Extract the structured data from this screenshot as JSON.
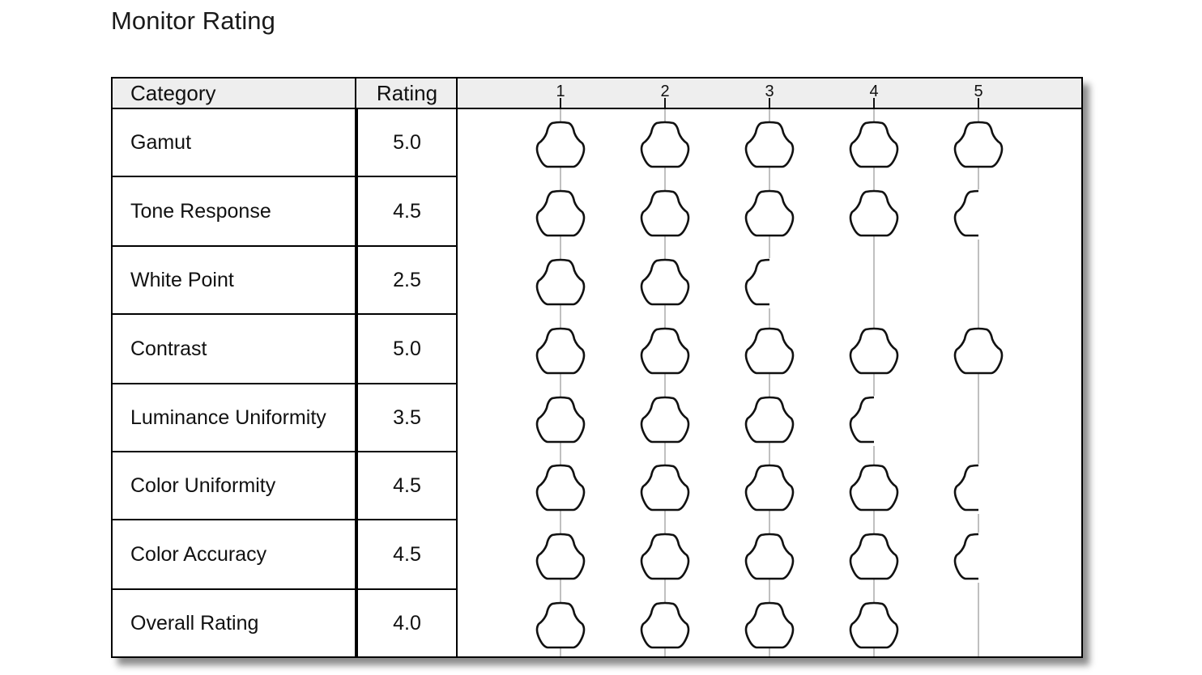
{
  "page": {
    "title": "Monitor Rating"
  },
  "table": {
    "headers": {
      "category": "Category",
      "rating": "Rating"
    },
    "rows": [
      {
        "category": "Gamut",
        "rating": "5.0"
      },
      {
        "category": "Tone Response",
        "rating": "4.5"
      },
      {
        "category": "White Point",
        "rating": "2.5"
      },
      {
        "category": "Contrast",
        "rating": "5.0"
      },
      {
        "category": "Luminance Uniformity",
        "rating": "3.5"
      },
      {
        "category": "Color Uniformity",
        "rating": "4.5"
      },
      {
        "category": "Color Accuracy",
        "rating": "4.5"
      },
      {
        "category": "Overall Rating",
        "rating": "4.0"
      }
    ]
  },
  "colors": {
    "header_bg": "#eeeeee",
    "border": "#000000",
    "guide_line": "#c0c0c0",
    "icon_stroke": "#111111"
  },
  "chart_data": {
    "type": "table",
    "title": "Monitor Rating",
    "xlabel": "",
    "ylabel": "",
    "scale_ticks": [
      "1",
      "2",
      "3",
      "4",
      "5"
    ],
    "xlim": [
      1,
      5
    ],
    "icon": "rounded-triangle-knob-icon",
    "categories": [
      "Gamut",
      "Tone Response",
      "White Point",
      "Contrast",
      "Luminance Uniformity",
      "Color Uniformity",
      "Color Accuracy",
      "Overall Rating"
    ],
    "values": [
      5.0,
      4.5,
      2.5,
      5.0,
      3.5,
      4.5,
      4.5,
      4.0
    ],
    "grid": true,
    "legend": "none"
  }
}
